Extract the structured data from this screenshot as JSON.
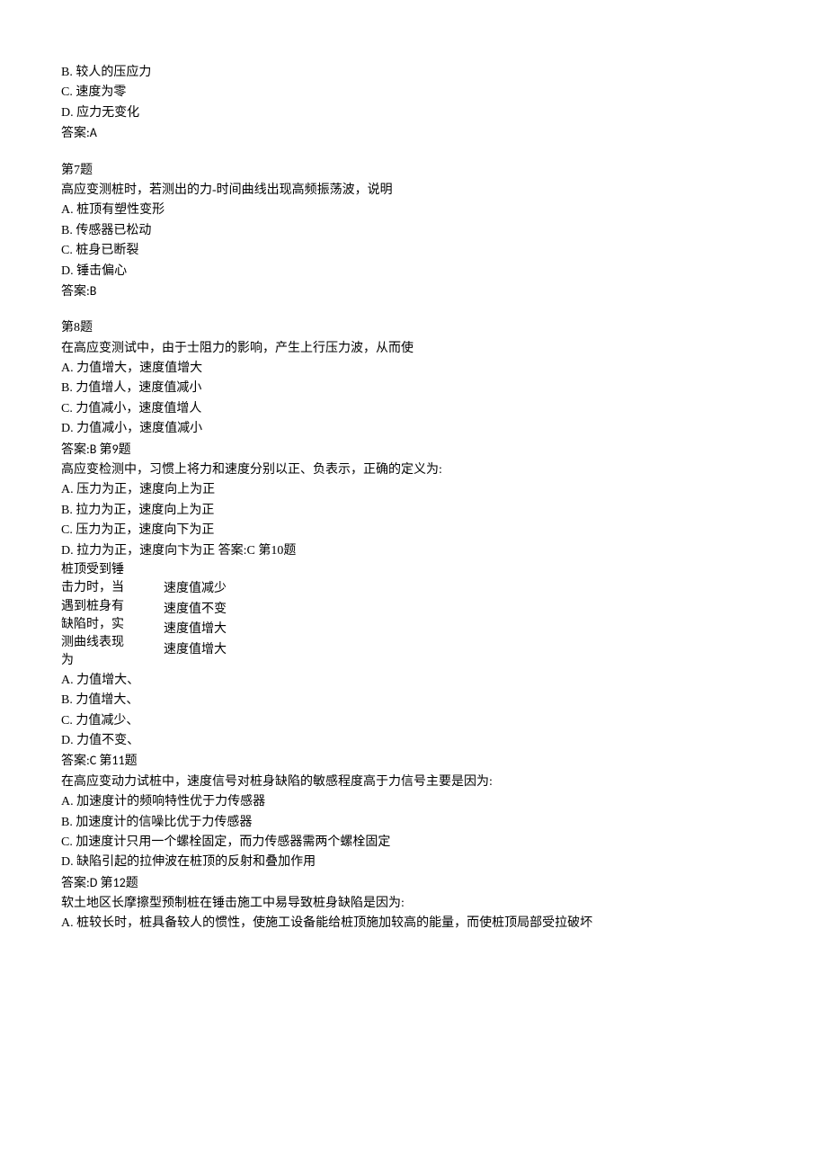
{
  "q6": {
    "optB": "B.  较人的压应力",
    "optC": "C.  速度为零",
    "optD": "D.  应力无变化",
    "answer": "答案:A"
  },
  "q7": {
    "title": "第7题",
    "stem": "高应变测桩时，若测出的力-时间曲线出现高频振荡波，说明",
    "optA": "A.  桩顶有塑性变形",
    "optB": "B.  传感器已松动",
    "optC": "C.  桩身已断裂",
    "optD": "D.  锤击偏心",
    "answer": "答案:B"
  },
  "q8": {
    "title": "第8题",
    "stem": "在高应变测试中，由于士阻力的影响，产生上行压力波，从而使",
    "optA": "A.  力值增大，速度值增大",
    "optB": "B.  力值增人，速度值减小",
    "optC": "C.  力值减小，速度值增人",
    "optD": "D.  力值减小，速度值减小",
    "answer_inline": "答案:B 第9题"
  },
  "q9": {
    "stem": "高应变检测中，习惯上将力和速度分别以正、负表示，正确的定义为:",
    "optA": "A.  压力为正，速度向上为正",
    "optB": "B.  拉力为正，速度向上为正",
    "optC": "C.  压力为正，速度向下为正",
    "optD": "D.  拉力为正，速度向卞为正",
    "answer_inline": "  答案:C 第10题"
  },
  "q10": {
    "col1": {
      "l1": "桩顶受到锤",
      "l2": "击力时，当",
      "l3": "遇到桩身有",
      "l4": "缺陷时，实",
      "l5": "测曲线表现",
      "l6": "为"
    },
    "col2": {
      "l1": "速度值减少",
      "l2": "速度值不变",
      "l3": "速度值增大",
      "l4": "速度值增大"
    },
    "optA": "A.  力值增大、",
    "optB": "B.  力值增大、",
    "optC": "C.  力值减少、",
    "optD": "D.  力值不变、",
    "answer_inline": "答案:C 第11题"
  },
  "q11": {
    "stem": "在高应变动力试桩中，速度信号对桩身缺陷的敏感程度高于力信号主要是因为:",
    "optA": "A.  加速度计的频响特性优于力传感器",
    "optB": "B.  加速度计的信噪比优于力传感器",
    "optC": "C.  加速度计只用一个螺栓固定，而力传感器需两个螺栓固定",
    "optD": "D.  缺陷引起的拉伸波在桩顶的反射和叠加作用",
    "answer_inline": "答案:D 第12题"
  },
  "q12": {
    "stem": "软土地区长摩擦型预制桩在锤击施工中易导致桩身缺陷是因为:",
    "optA": "A.      桩较长时，桩具备较人的惯性，使施工设备能给桩顶施加较高的能量，而使桩顶局部受拉破坏"
  }
}
